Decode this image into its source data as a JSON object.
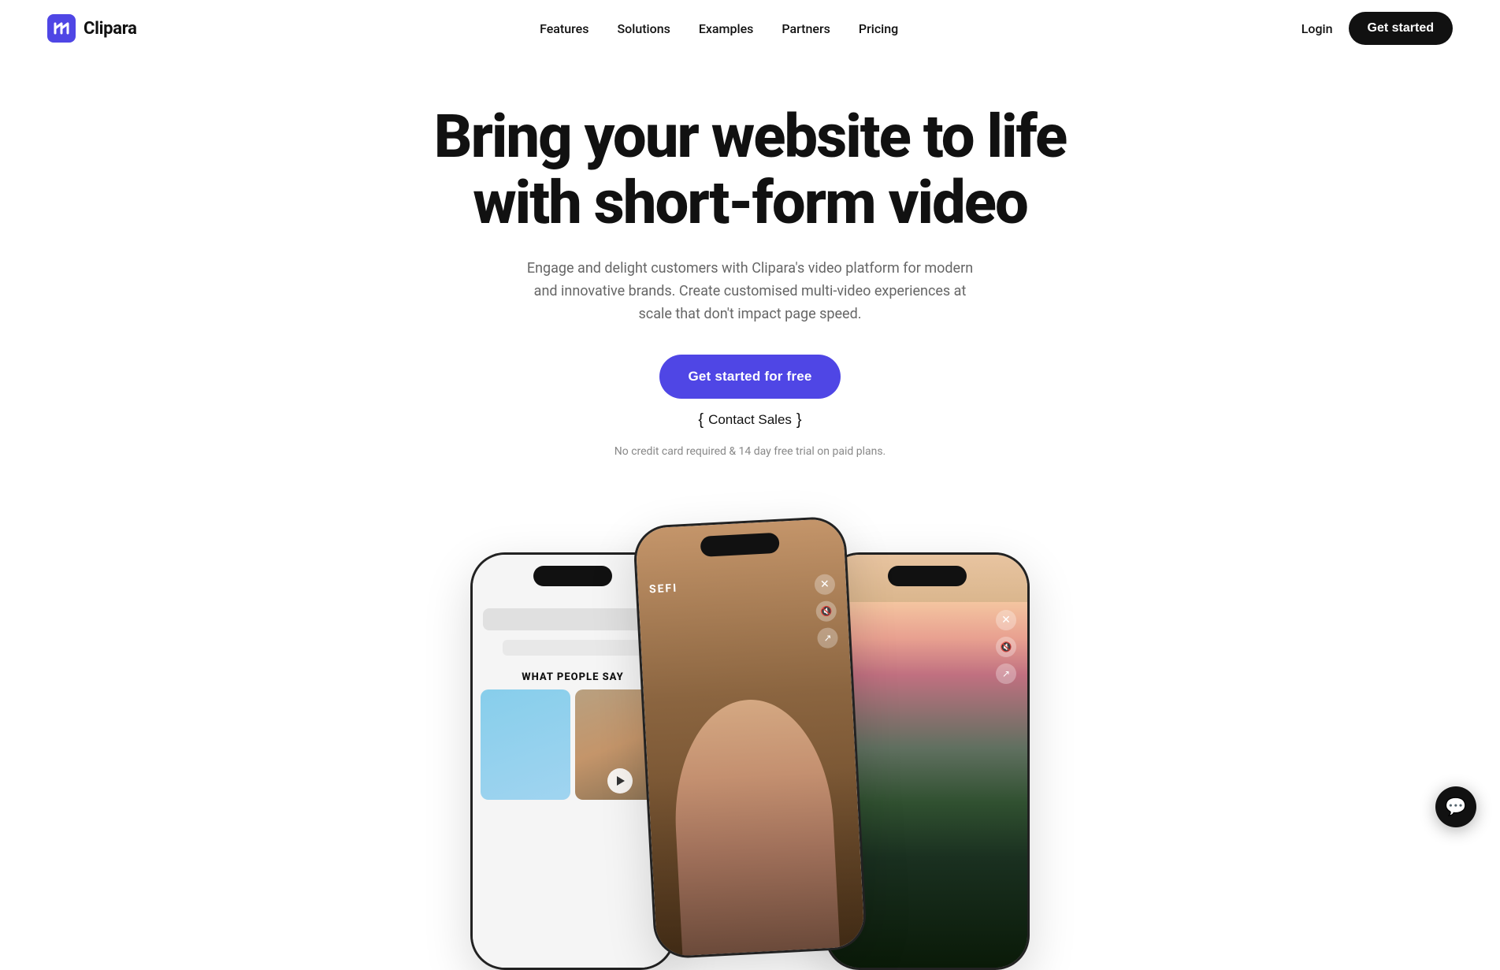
{
  "brand": {
    "name": "Clipara",
    "logo_alt": "Clipara logo"
  },
  "navbar": {
    "links": [
      {
        "id": "features",
        "label": "Features"
      },
      {
        "id": "solutions",
        "label": "Solutions"
      },
      {
        "id": "examples",
        "label": "Examples"
      },
      {
        "id": "partners",
        "label": "Partners"
      },
      {
        "id": "pricing",
        "label": "Pricing"
      }
    ],
    "login_label": "Login",
    "get_started_label": "Get started"
  },
  "hero": {
    "title_line1": "Bring your website to life",
    "title_line2": "with short-form video",
    "subtitle": "Engage and delight customers with Clipara's video platform for modern and innovative brands. Create customised multi-video experiences at scale that don't impact page speed.",
    "cta_primary_label": "Get started for free",
    "cta_secondary_label": "Contact Sales",
    "no_credit_card_text": "No credit card required & 14 day free trial on paid plans."
  },
  "phones": {
    "left": {
      "section_label": "WHAT PEOPLE SAY"
    },
    "center": {
      "brand_label": "SEFI"
    },
    "right": {}
  },
  "chat": {
    "icon": "💬"
  },
  "colors": {
    "primary_cta": "#4F46E5",
    "dark": "#111111",
    "white": "#ffffff",
    "text_muted": "#666666"
  }
}
